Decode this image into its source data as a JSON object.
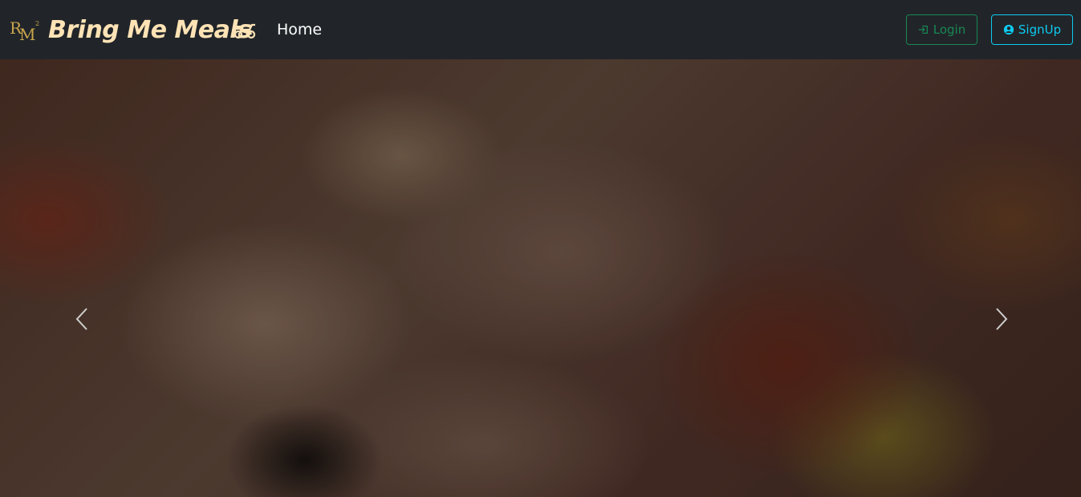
{
  "brand": {
    "name": "Bring Me Meals",
    "logo_icon": "bm-monogram-logo",
    "vehicle_icon": "scooter-icon",
    "color": "#ffe3b5"
  },
  "nav": {
    "items": [
      {
        "label": "Home"
      }
    ]
  },
  "auth": {
    "login_label": "Login",
    "login_icon": "login-icon",
    "login_color": "#198754",
    "signup_label": "SignUp",
    "signup_icon": "user-circle-icon",
    "signup_color": "#0dcaf0"
  },
  "carousel": {
    "image": "pizza-closeup",
    "prev_icon": "chevron-left-icon",
    "next_icon": "chevron-right-icon"
  },
  "colors": {
    "navbar_bg": "#212529"
  }
}
